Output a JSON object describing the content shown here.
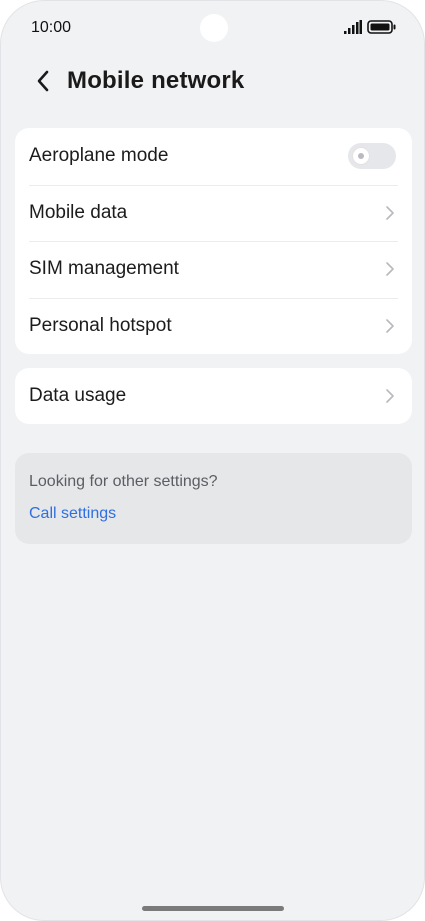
{
  "status_bar": {
    "time": "10:00"
  },
  "header": {
    "title": "Mobile network"
  },
  "network_settings": {
    "items": [
      {
        "label": "Aeroplane mode",
        "control": "toggle",
        "on": false
      },
      {
        "label": "Mobile data",
        "control": "chevron"
      },
      {
        "label": "SIM management",
        "control": "chevron"
      },
      {
        "label": "Personal hotspot",
        "control": "chevron"
      }
    ]
  },
  "usage": {
    "label": "Data usage"
  },
  "suggestions": {
    "prompt": "Looking for other settings?",
    "link": "Call settings"
  },
  "colors": {
    "link": "#2f6fe0",
    "background": "#f1f2f4",
    "card": "#ffffff"
  },
  "icons": [
    "back-arrow-icon",
    "signal-icon",
    "battery-icon",
    "chevron-right-icon",
    "toggle-switch"
  ]
}
